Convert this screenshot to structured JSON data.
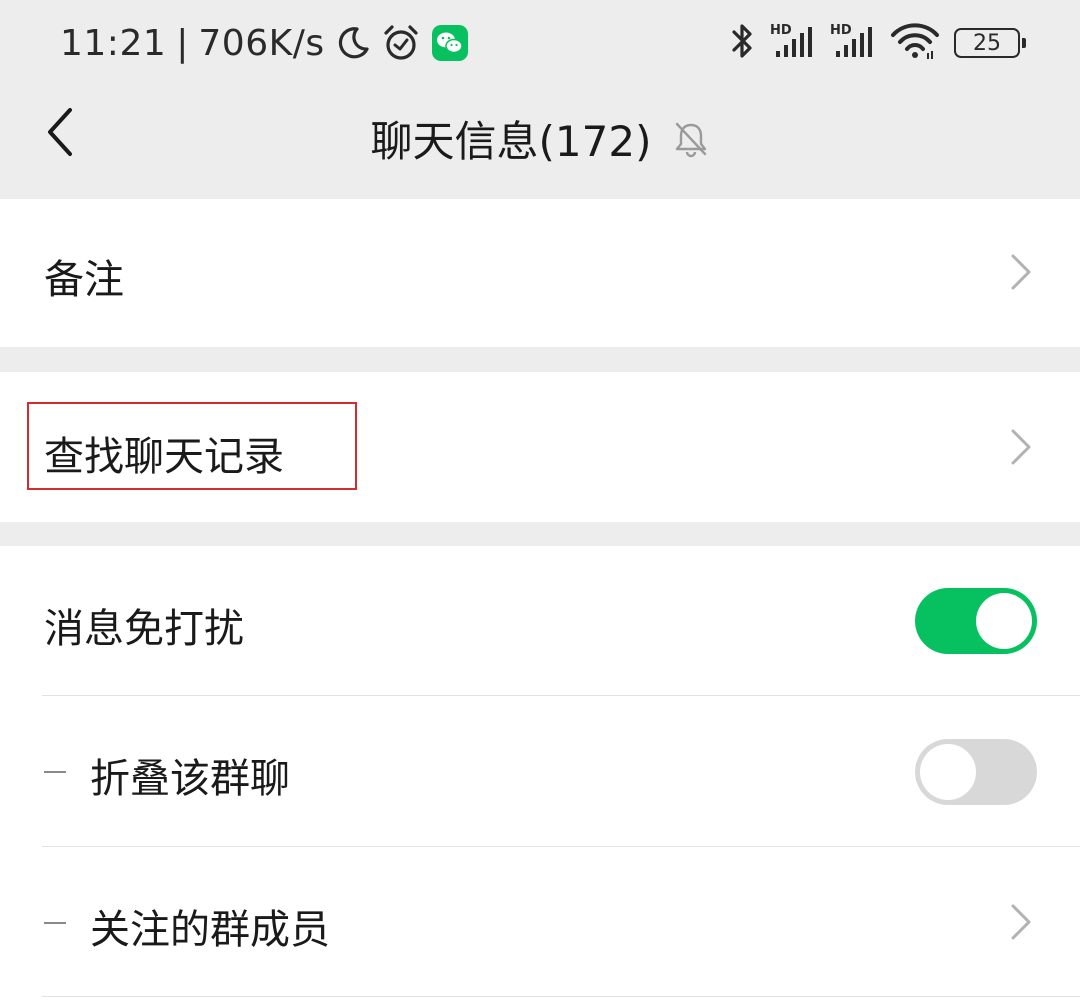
{
  "status_bar": {
    "time": "11:21",
    "separator": "|",
    "net_speed": "706K/s",
    "battery_level": "25",
    "icons": [
      "moon-icon",
      "alarm-icon",
      "wechat-app-icon",
      "bluetooth-icon",
      "signal-hd-icon",
      "signal-hd-icon",
      "wifi-icon",
      "battery-icon"
    ]
  },
  "nav": {
    "title": "聊天信息(172)",
    "back_icon": "chevron-left-icon",
    "mute_icon": "bell-muted-icon"
  },
  "rows": {
    "remark": {
      "label": "备注"
    },
    "search_history": {
      "label": "查找聊天记录",
      "highlight_color": "#d62b2b"
    },
    "mute": {
      "label": "消息免打扰",
      "toggle_on": true
    },
    "fold": {
      "label": "折叠该群聊",
      "toggle_on": false
    },
    "followed_members": {
      "label": "关注的群成员"
    }
  },
  "colors": {
    "accent_green": "#07c160",
    "background": "#ededed",
    "toggle_off": "#d8d8d8"
  }
}
